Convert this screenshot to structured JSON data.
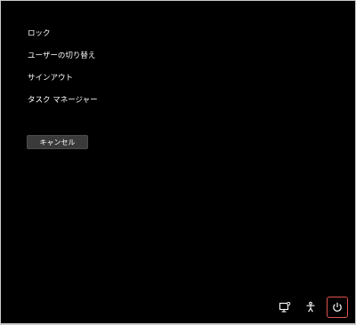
{
  "menu": {
    "items": [
      {
        "label": "ロック"
      },
      {
        "label": "ユーザーの切り替え"
      },
      {
        "label": "サインアウト"
      },
      {
        "label": "タスク マネージャー"
      }
    ]
  },
  "cancel_button": {
    "label": "キャンセル"
  },
  "tray": {
    "icons": [
      "network-icon",
      "accessibility-icon",
      "power-icon"
    ]
  },
  "colors": {
    "background": "#000000",
    "text": "#ffffff",
    "button_bg": "#3a3a3a",
    "highlight": "#e0524f"
  }
}
